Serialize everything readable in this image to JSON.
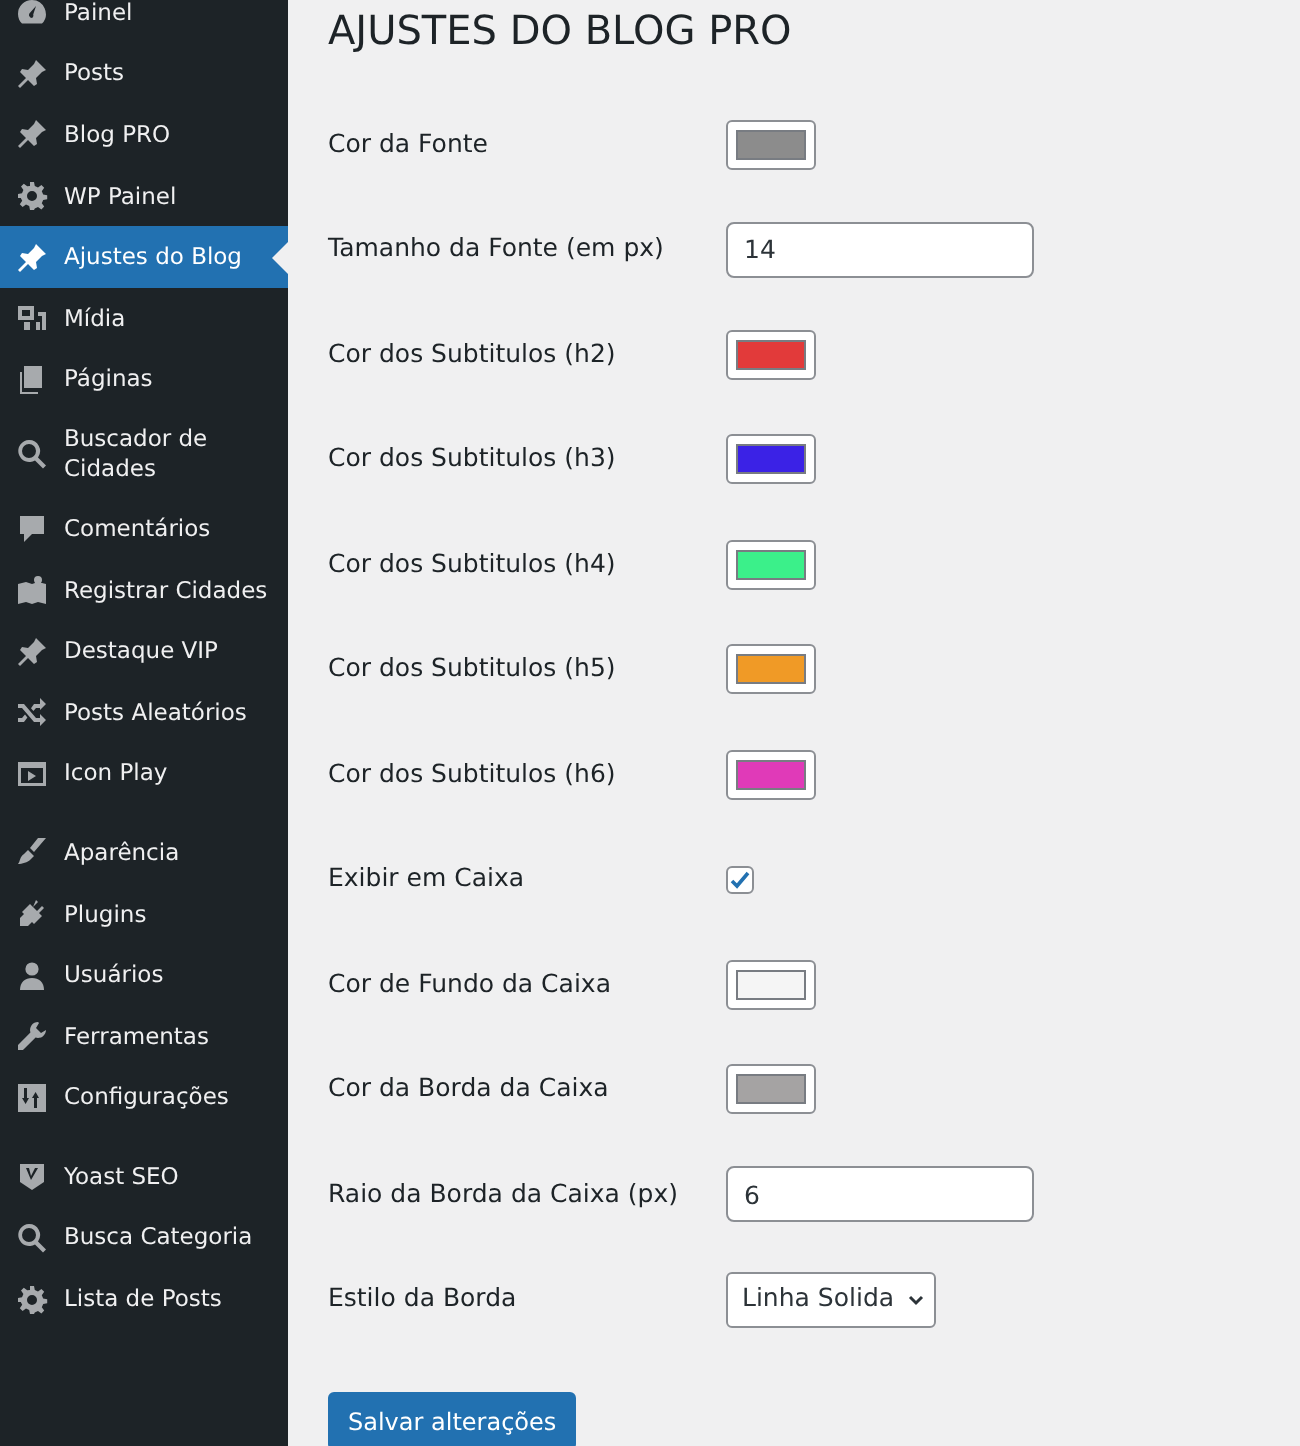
{
  "sidebar": {
    "groups": [
      {
        "items": [
          {
            "label": "Painel",
            "selected": false
          },
          {
            "label": "Posts",
            "selected": false
          },
          {
            "label": "Blog PRO",
            "selected": false
          },
          {
            "label": "WP Painel",
            "selected": false
          },
          {
            "label": "Ajustes do Blog",
            "selected": true
          },
          {
            "label": "Mídia",
            "selected": false
          },
          {
            "label": "Páginas",
            "selected": false
          },
          {
            "label": "Buscador de Cidades",
            "selected": false
          },
          {
            "label": "Comentários",
            "selected": false
          },
          {
            "label": "Registrar Cidades",
            "selected": false
          },
          {
            "label": "Destaque VIP",
            "selected": false
          },
          {
            "label": "Posts Aleatórios",
            "selected": false
          },
          {
            "label": "Icon Play",
            "selected": false
          }
        ]
      },
      {
        "items": [
          {
            "label": "Aparência",
            "selected": false
          },
          {
            "label": "Plugins",
            "selected": false
          },
          {
            "label": "Usuários",
            "selected": false
          },
          {
            "label": "Ferramentas",
            "selected": false
          },
          {
            "label": "Configurações",
            "selected": false
          }
        ]
      },
      {
        "items": [
          {
            "label": "Yoast SEO",
            "selected": false
          },
          {
            "label": "Busca Categoria",
            "selected": false
          },
          {
            "label": "Lista de Posts",
            "selected": false
          }
        ]
      }
    ]
  },
  "page": {
    "title": "AJUSTES DO BLOG PRO",
    "fields": [
      {
        "kind": "color",
        "label": "Cor da Fonte",
        "color": "#8c8c8c"
      },
      {
        "kind": "number",
        "label": "Tamanho da Fonte (em px)",
        "value": "14"
      },
      {
        "kind": "color",
        "label": "Cor dos Subtitulos (h2)",
        "color": "#e23a3a"
      },
      {
        "kind": "color",
        "label": "Cor dos Subtitulos (h3)",
        "color": "#3b22e6"
      },
      {
        "kind": "color",
        "label": "Cor dos Subtitulos (h4)",
        "color": "#3bf08a"
      },
      {
        "kind": "color",
        "label": "Cor dos Subtitulos (h5)",
        "color": "#f09a26"
      },
      {
        "kind": "color",
        "label": "Cor dos Subtitulos (h6)",
        "color": "#e03ab8"
      },
      {
        "kind": "checkbox",
        "label": "Exibir em Caixa",
        "checked": true
      },
      {
        "kind": "color",
        "label": "Cor de Fundo da Caixa",
        "color": "#f5f5f5"
      },
      {
        "kind": "color",
        "label": "Cor da Borda da Caixa",
        "color": "#a5a3a3"
      },
      {
        "kind": "number",
        "label": "Raio da Borda da Caixa (px)",
        "value": "6"
      },
      {
        "kind": "select",
        "label": "Estilo da Borda",
        "value": "Linha Solida"
      }
    ],
    "save_button": "Salvar alterações"
  }
}
